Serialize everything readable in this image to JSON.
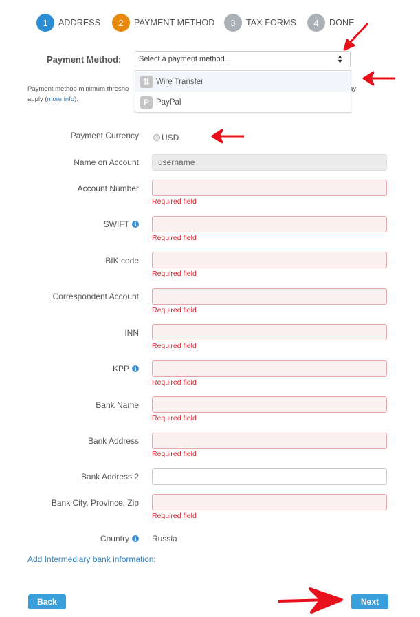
{
  "steps": [
    {
      "number": "1",
      "label": "ADDRESS",
      "color": "#2d8dd3"
    },
    {
      "number": "2",
      "label": "PAYMENT METHOD",
      "color": "#e8890c"
    },
    {
      "number": "3",
      "label": "TAX FORMS",
      "color": "#a9b1b7"
    },
    {
      "number": "4",
      "label": "DONE",
      "color": "#a9b1b7"
    }
  ],
  "payment_method": {
    "label": "Payment Method:",
    "placeholder": "Select a payment method...",
    "options": [
      {
        "label": "Wire Transfer",
        "icon": "wire-transfer-icon",
        "glyph": "⇅"
      },
      {
        "label": "PayPal",
        "icon": "paypal-icon",
        "glyph": "P"
      }
    ]
  },
  "note": {
    "text_left": "Payment method minimum thresho",
    "text_right": "ee may",
    "text_line2_prefix": "apply (",
    "link": "more info",
    "text_line2_suffix": ")."
  },
  "currency": {
    "label": "Payment Currency",
    "option": "USD"
  },
  "fields": [
    {
      "label": "Name on Account",
      "value": "username",
      "state": "readonly",
      "info": false
    },
    {
      "label": "Account Number",
      "value": "",
      "state": "error",
      "info": false
    },
    {
      "label": "SWIFT",
      "value": "",
      "state": "error",
      "info": true
    },
    {
      "label": "BIK code",
      "value": "",
      "state": "error",
      "info": false
    },
    {
      "label": "Correspondent Account",
      "value": "",
      "state": "error",
      "info": false
    },
    {
      "label": "INN",
      "value": "",
      "state": "error",
      "info": false
    },
    {
      "label": "KPP",
      "value": "",
      "state": "error",
      "info": true
    },
    {
      "label": "Bank Name",
      "value": "",
      "state": "error",
      "info": false
    },
    {
      "label": "Bank Address",
      "value": "",
      "state": "error",
      "info": false
    },
    {
      "label": "Bank Address 2",
      "value": "",
      "state": "normal",
      "info": false
    },
    {
      "label": "Bank City, Province, Zip",
      "value": "",
      "state": "error",
      "info": false
    }
  ],
  "required_text": "Required field",
  "country": {
    "label": "Country",
    "value": "Russia"
  },
  "intermediary_link": "Add Intermediary bank information:",
  "buttons": {
    "back": "Back",
    "next": "Next"
  },
  "info_glyph": "i"
}
